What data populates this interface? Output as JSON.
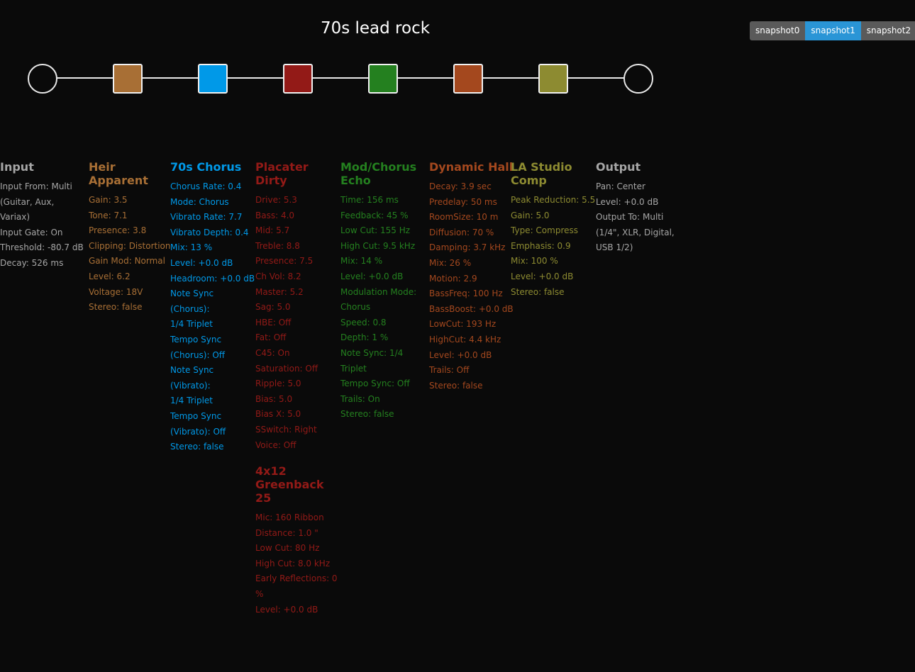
{
  "preset": {
    "title": "70s lead rock"
  },
  "snapshots": {
    "items": [
      "snapshot0",
      "snapshot1",
      "snapshot2"
    ],
    "active": "snapshot1"
  },
  "chain_colors": {
    "heir_apparent": "#a86f35",
    "chorus_70s": "#0099e8",
    "placater_dirty": "#931a17",
    "mod_chorus_echo": "#24801f",
    "dynamic_hall": "#a4481e",
    "la_studio_comp": "#8d8b31"
  },
  "blocks": {
    "input": {
      "title": "Input",
      "color": "#a6a6a6",
      "params": [
        "Input From: Multi",
        "(Guitar, Aux, Variax)",
        "Input Gate: On",
        "Threshold: -80.7 dB",
        "Decay: 526 ms"
      ]
    },
    "heir_apparent": {
      "title": "Heir Apparent",
      "color": "#a86f35",
      "params": [
        "Gain: 3.5",
        "Tone: 7.1",
        "Presence: 3.8",
        "Clipping: Distortion",
        "Gain Mod: Normal",
        "Level: 6.2",
        "Voltage: 18V",
        "Stereo: false"
      ]
    },
    "chorus_70s": {
      "title": "70s Chorus",
      "color": "#0099e8",
      "params": [
        "Chorus Rate: 0.4",
        "Mode: Chorus",
        "Vibrato Rate: 7.7",
        "Vibrato Depth: 0.4",
        "Mix: 13 %",
        "Level: +0.0 dB",
        "Headroom: +0.0 dB",
        "Note Sync (Chorus):",
        "1/4 Triplet",
        "Tempo Sync",
        "(Chorus): Off",
        "Note Sync (Vibrato):",
        "1/4 Triplet",
        "Tempo Sync",
        "(Vibrato): Off",
        "Stereo: false"
      ]
    },
    "placater_dirty": {
      "title": "Placater Dirty",
      "color": "#931a17",
      "params": [
        "Drive: 5.3",
        "Bass: 4.0",
        "Mid: 5.7",
        "Treble: 8.8",
        "Presence: 7.5",
        "Ch Vol: 8.2",
        "Master: 5.2",
        "Sag: 5.0",
        "HBE: Off",
        "Fat: Off",
        "C45: On",
        "Saturation: Off",
        "Ripple: 5.0",
        "Bias: 5.0",
        "Bias X: 5.0",
        "SSwitch: Right",
        "Voice: Off"
      ]
    },
    "cab": {
      "title_line1": "4x12",
      "title_line2": "Greenback 25",
      "color": "#931a17",
      "params": [
        "Mic: 160 Ribbon",
        "Distance: 1.0 \"",
        "Low Cut: 80 Hz",
        "High Cut: 8.0 kHz",
        "Early Reflections: 0",
        "%",
        "Level: +0.0 dB"
      ]
    },
    "mod_chorus_echo": {
      "title_line1": "Mod/Chorus",
      "title_line2": "Echo",
      "color": "#24801f",
      "params": [
        "Time: 156 ms",
        "Feedback: 45 %",
        "Low Cut: 155 Hz",
        "High Cut: 9.5 kHz",
        "Mix: 14 %",
        "Level: +0.0 dB",
        "Modulation Mode:",
        "Chorus",
        "Speed: 0.8",
        "Depth: 1 %",
        "Note Sync: 1/4",
        "Triplet",
        "Tempo Sync: Off",
        "Trails: On",
        "Stereo: false"
      ]
    },
    "dynamic_hall": {
      "title": "Dynamic Hall",
      "color": "#a4481e",
      "params": [
        "Decay: 3.9 sec",
        "Predelay: 50 ms",
        "RoomSize: 10 m",
        "Diffusion: 70 %",
        "Damping: 3.7 kHz",
        "Mix: 26 %",
        "Motion: 2.9",
        "BassFreq: 100 Hz",
        "BassBoost: +0.0 dB",
        "LowCut: 193 Hz",
        "HighCut: 4.4 kHz",
        "Level: +0.0 dB",
        "Trails: Off",
        "Stereo: false"
      ]
    },
    "la_studio_comp": {
      "title_line1": "LA Studio",
      "title_line2": "Comp",
      "color": "#8d8b31",
      "params": [
        "Peak Reduction: 5.5",
        "Gain: 5.0",
        "Type: Compress",
        "Emphasis: 0.9",
        "Mix: 100 %",
        "Level: +0.0 dB",
        "Stereo: false"
      ]
    },
    "output": {
      "title": "Output",
      "color": "#a6a6a6",
      "params": [
        "Pan: Center",
        "Level: +0.0 dB",
        "Output To: Multi",
        "(1/4\", XLR, Digital,",
        "USB 1/2)"
      ]
    }
  }
}
